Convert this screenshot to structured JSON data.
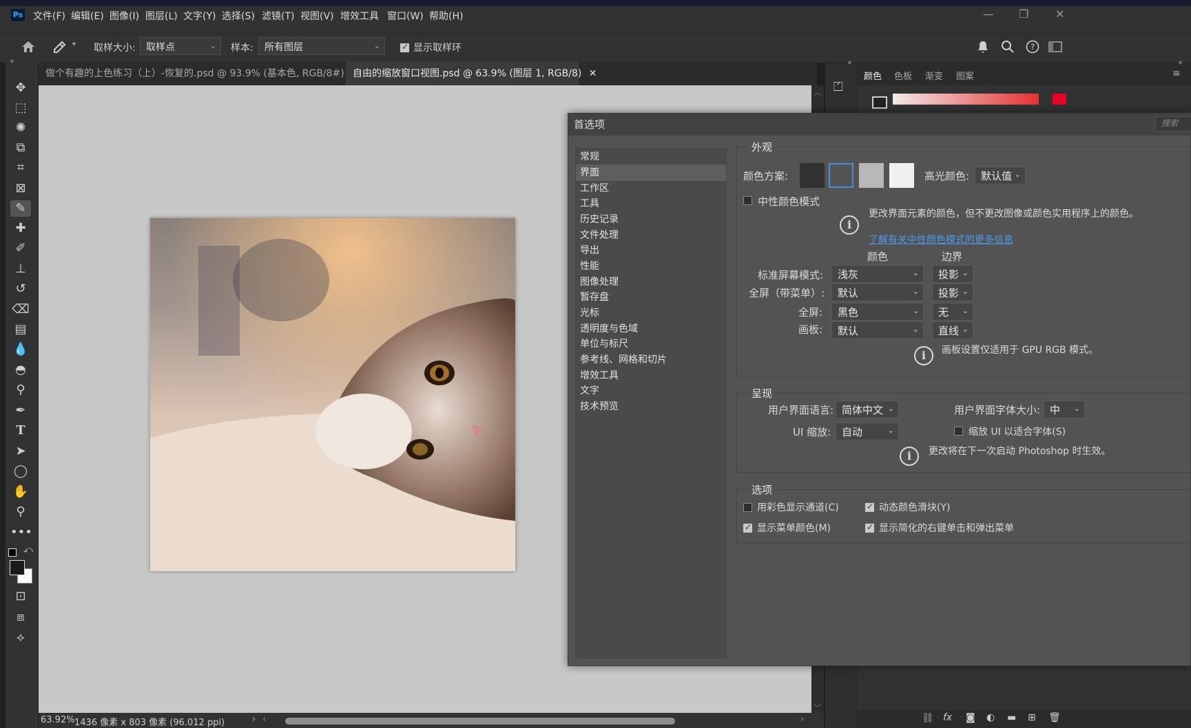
{
  "app": {
    "logo": "Ps"
  },
  "menubar": {
    "items": [
      "文件(F)",
      "编辑(E)",
      "图像(I)",
      "图层(L)",
      "文字(Y)",
      "选择(S)",
      "滤镜(T)",
      "视图(V)",
      "增效工具",
      "窗口(W)",
      "帮助(H)"
    ]
  },
  "options_bar": {
    "sample_size_label": "取样大小:",
    "sample_size_value": "取样点",
    "sample_label": "样本:",
    "sample_value": "所有图层",
    "show_ring_label": "显示取样环",
    "show_ring_checked": true
  },
  "tabs": [
    {
      "label": "做个有趣的上色练习（上）-恢复的.psd @ 93.9% (基本色, RGB/8#) *",
      "active": false
    },
    {
      "label": "自由的缩放窗口视图.psd @ 63.9% (图层 1, RGB/8)",
      "active": true
    }
  ],
  "status_bar": {
    "zoom": "63.92%",
    "info": "1436 像素 x 803 像素 (96.012 ppi)"
  },
  "right_panel": {
    "tabs": [
      "颜色",
      "色板",
      "渐变",
      "图案"
    ],
    "search_placeholder": "搜索"
  },
  "preferences": {
    "title": "首选项",
    "nav": [
      "常规",
      "界面",
      "工作区",
      "工具",
      "历史记录",
      "文件处理",
      "导出",
      "性能",
      "图像处理",
      "暂存盘",
      "光标",
      "透明度与色域",
      "单位与标尺",
      "参考线、网格和切片",
      "增效工具",
      "文字",
      "技术预览"
    ],
    "selected_nav": "界面",
    "appearance": {
      "title": "外观",
      "color_scheme_label": "颜色方案:",
      "color_scheme_colors": [
        "#323232",
        "#535353",
        "#b8b8b8",
        "#f0f0f0"
      ],
      "highlight_label": "高光颜色:",
      "highlight_value": "默认值",
      "neutral_mode_label": "中性颜色模式",
      "neutral_mode_checked": false,
      "info_text": "更改界面元素的颜色，但不更改图像或颜色实用程序上的颜色。",
      "learn_more_link": "了解有关中性颜色模式的更多信息",
      "col_color": "颜色",
      "col_border": "边界",
      "rows": [
        {
          "label": "标准屏幕模式:",
          "color": "浅灰",
          "border": "投影"
        },
        {
          "label": "全屏（带菜单）:",
          "color": "默认",
          "border": "投影"
        },
        {
          "label": "全屏:",
          "color": "黑色",
          "border": "无"
        },
        {
          "label": "画板:",
          "color": "默认",
          "border": "直线"
        }
      ],
      "artboard_note": "画板设置仅适用于 GPU RGB 模式。"
    },
    "presentation": {
      "title": "呈现",
      "language_label": "用户界面语言:",
      "language_value": "简体中文",
      "font_size_label": "用户界面字体大小:",
      "font_size_value": "中",
      "ui_scale_label": "UI 缩放:",
      "ui_scale_value": "自动",
      "scale_to_font_label": "缩放 UI 以适合字体(S)",
      "scale_to_font_checked": false,
      "restart_note": "更改将在下一次启动 Photoshop 时生效。"
    },
    "options": {
      "title": "选项",
      "items": [
        {
          "label": "用彩色显示通道(C)",
          "checked": false
        },
        {
          "label": "动态颜色滑块(Y)",
          "checked": true
        },
        {
          "label": "显示菜单颜色(M)",
          "checked": true
        },
        {
          "label": "显示简化的右键单击和弹出菜单",
          "checked": true
        }
      ]
    }
  }
}
